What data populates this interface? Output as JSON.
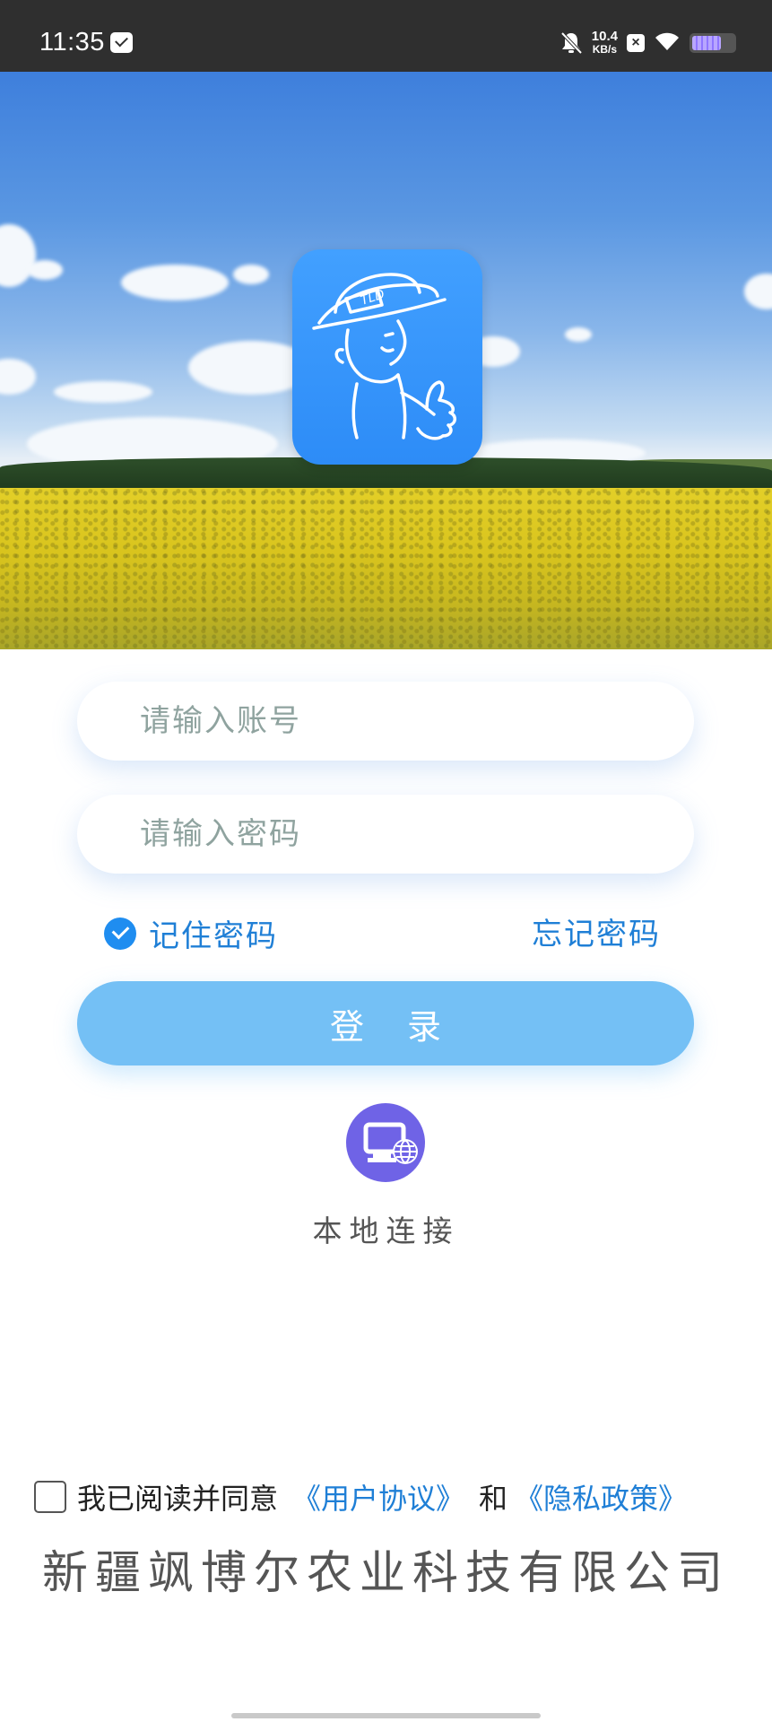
{
  "status_bar": {
    "time": "11:35",
    "net_speed_value": "10.4",
    "net_speed_unit": "KB/s",
    "icons": [
      "message-icon",
      "mute-bell-icon",
      "close-box-icon",
      "wifi-icon",
      "battery-icon"
    ]
  },
  "login": {
    "account_placeholder": "请输入账号",
    "account_value": "",
    "password_placeholder": "请输入密码",
    "password_value": "",
    "remember_label": "记住密码",
    "remember_checked": true,
    "forgot_label": "忘记密码",
    "login_label": "登 录",
    "local_connect_label": "本地连接"
  },
  "agreement": {
    "prefix": "我已阅读并同意",
    "user_agreement": "《用户协议》",
    "joiner": "和",
    "privacy_policy": "《隐私政策》",
    "checked": false
  },
  "footer": {
    "company": "新疆飒博尔农业科技有限公司"
  },
  "colors": {
    "accent": "#1f7fd6",
    "login_button": "#74c0f5",
    "status_bar": "#2f2f2f",
    "logo_bg": "#2d8cf7"
  }
}
